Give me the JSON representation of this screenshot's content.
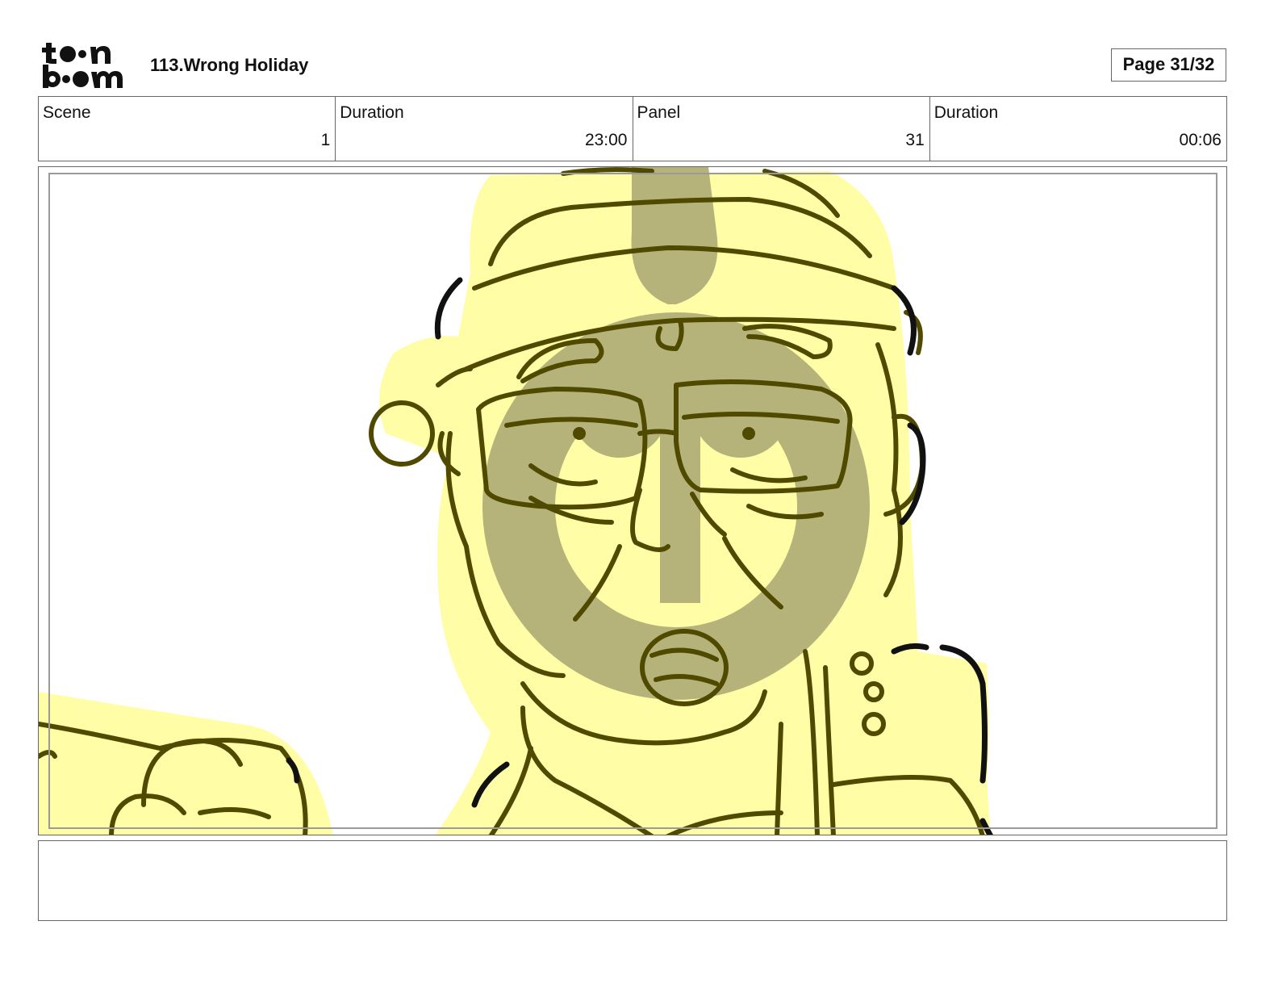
{
  "header": {
    "logo_text": "toon boom",
    "project_title": "113.Wrong Holiday",
    "page_indicator": "Page 31/32"
  },
  "info": {
    "scene_label": "Scene",
    "scene_value": "1",
    "scene_duration_label": "Duration",
    "scene_duration_value": "23:00",
    "panel_label": "Panel",
    "panel_value": "31",
    "panel_duration_label": "Duration",
    "panel_duration_value": "00:06"
  },
  "panel": {
    "image_description": "",
    "line_color": "#4f4a00",
    "fill_color": "#fffea6",
    "watermark_color": "#b5b37a"
  },
  "notes": {
    "text": ""
  }
}
